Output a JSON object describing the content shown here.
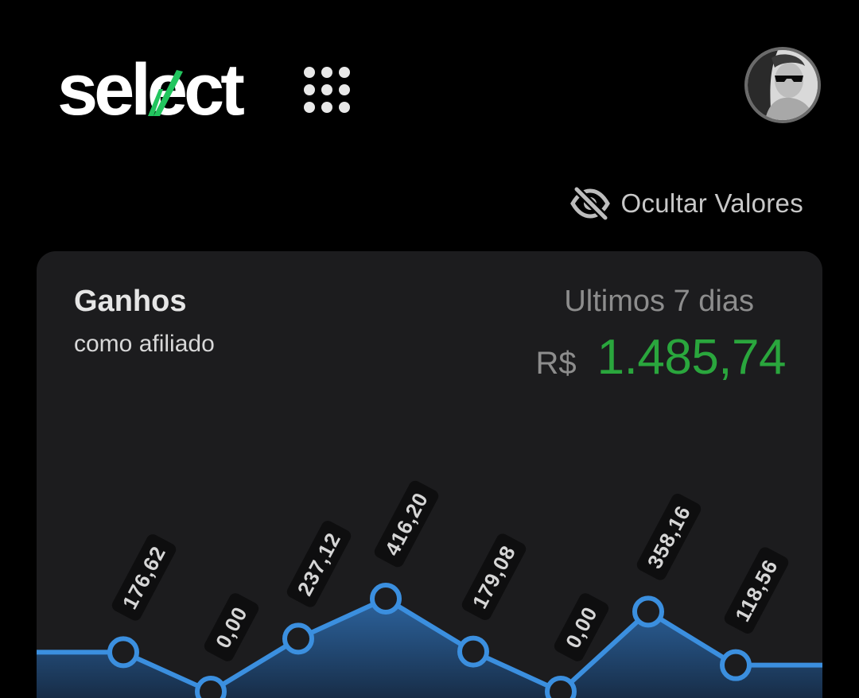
{
  "header": {
    "logo_text": "select",
    "apps_icon": "grid-icon",
    "avatar_icon": "user-avatar"
  },
  "toolbar": {
    "hide_values_label": "Ocultar Valores",
    "hide_values_icon": "eye-off-icon"
  },
  "card": {
    "title": "Ganhos",
    "subtitle": "como afiliado",
    "period": "Ultimos 7 dias",
    "currency": "R$",
    "amount": "1.485,74"
  },
  "colors": {
    "background": "#000000",
    "card": "#1c1c1e",
    "accent_green": "#2aa63d",
    "logo_check": "#22c55e",
    "line": "#3b8fdf",
    "label_bg": "#0e0e0f"
  },
  "chart_data": {
    "type": "line",
    "x": [
      1,
      2,
      3,
      4,
      5,
      6,
      7,
      8
    ],
    "values": [
      176.62,
      0.0,
      237.12,
      416.2,
      179.08,
      0.0,
      358.16,
      118.56
    ],
    "labels": [
      "176,62",
      "0,00",
      "237,12",
      "416,20",
      "179,08",
      "0,00",
      "358,16",
      "118,56"
    ],
    "title": "",
    "xlabel": "",
    "ylabel": "",
    "area_fill": true,
    "grid": false,
    "legend": "none"
  }
}
